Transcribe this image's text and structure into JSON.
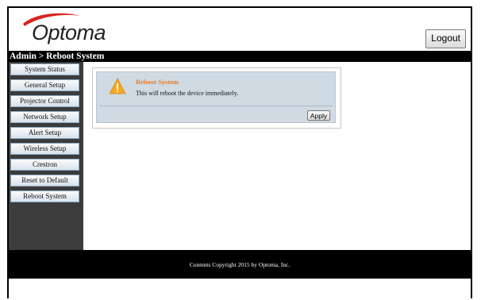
{
  "brand": {
    "logo_text": "Optoma",
    "logo_color": "#d7241e"
  },
  "header": {
    "logout_label": "Logout"
  },
  "breadcrumb": {
    "text": "Admin > Reboot System"
  },
  "sidebar": {
    "items": [
      {
        "label": "System Status"
      },
      {
        "label": "General Setup"
      },
      {
        "label": "Projector Control"
      },
      {
        "label": "Network Setup"
      },
      {
        "label": "Alert Setup"
      },
      {
        "label": "Wireless Setup"
      },
      {
        "label": "Crestron"
      },
      {
        "label": "Reset to Default"
      },
      {
        "label": "Reboot System"
      }
    ]
  },
  "panel": {
    "title": "Reboot System",
    "message": "This will reboot the device immediately.",
    "apply_label": "Apply",
    "icon": "warning-icon"
  },
  "footer": {
    "copyright": "Contents Copyright 2015 by Optoma, Inc."
  },
  "colors": {
    "accent_orange": "#e87d27",
    "panel_bg": "#cfdae3",
    "sidebar_bg": "#3c3c3c"
  }
}
